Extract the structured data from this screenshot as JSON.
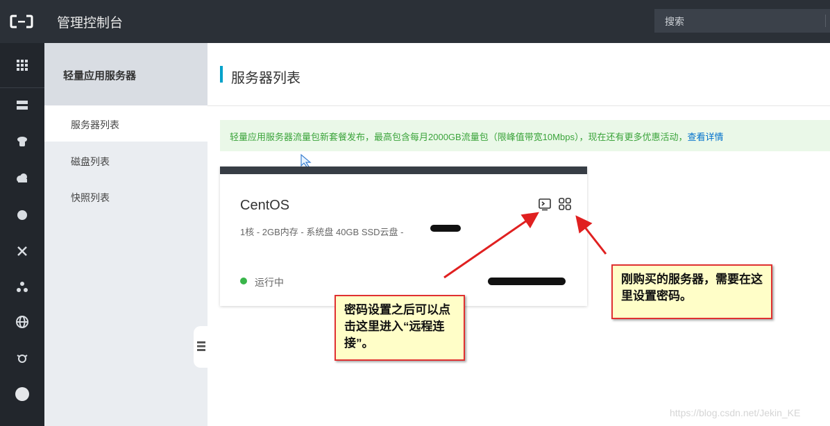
{
  "header": {
    "app_title": "管理控制台",
    "search_placeholder": "搜索"
  },
  "rail": {
    "icons": [
      "grid-icon",
      "server-icon",
      "database-icon",
      "cloud-icon",
      "cloud-upload-icon",
      "network-icon",
      "cluster-icon",
      "globe-icon",
      "bug-icon",
      "circle-icon"
    ]
  },
  "sidebar": {
    "title": "轻量应用服务器",
    "items": [
      {
        "label": "服务器列表",
        "active": true
      },
      {
        "label": "磁盘列表",
        "active": false
      },
      {
        "label": "快照列表",
        "active": false
      }
    ]
  },
  "main": {
    "title": "服务器列表",
    "notice": {
      "text": "轻量应用服务器流量包新套餐发布，最高包含每月2000GB流量包（限峰值带宽10Mbps），现在还有更多优惠活动，",
      "link": "查看详情"
    },
    "server_card": {
      "name": "CentOS",
      "spec": "1核 - 2GB内存 - 系统盘 40GB SSD云盘 -",
      "status": "运行中",
      "status_color": "#39b54a"
    }
  },
  "annotations": {
    "remote_connect": "密码设置之后可以点击这里进入“远程连接”。",
    "set_password": "刚购买的服务器，需要在这里设置密码。"
  },
  "watermark": "https://blog.csdn.net/Jekin_KE",
  "colors": {
    "accent": "#00a2ca",
    "topbar": "#2b3037",
    "rail": "#22262c",
    "annotation_border": "#e03030"
  }
}
